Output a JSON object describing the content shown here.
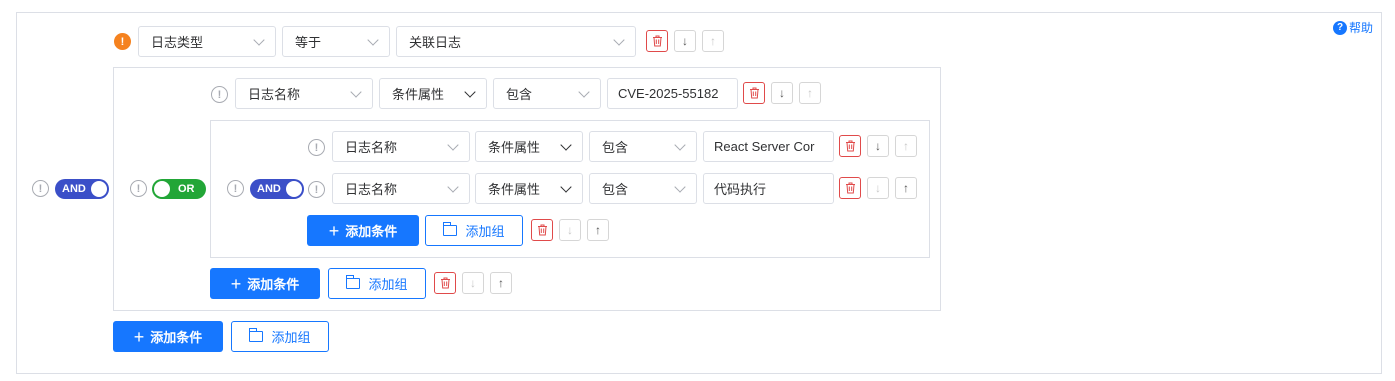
{
  "help": {
    "icon": "help-circle-icon",
    "label": "帮助"
  },
  "toggles": {
    "and_label": "AND",
    "or_label": "OR"
  },
  "top_condition": {
    "field": "日志类型",
    "operator": "等于",
    "value": "关联日志"
  },
  "group1": {
    "condition1": {
      "field": "日志名称",
      "attribute": "条件属性",
      "operator": "包含",
      "value": "CVE-2025-55182"
    },
    "inner_group": {
      "condition1": {
        "field": "日志名称",
        "attribute": "条件属性",
        "operator": "包含",
        "value": "React Server Cor"
      },
      "condition2": {
        "field": "日志名称",
        "attribute": "条件属性",
        "operator": "包含",
        "value": "代码执行"
      }
    }
  },
  "actions": {
    "add_condition": "添加条件",
    "add_group": "添加组"
  },
  "glyphs": {
    "warn": "!",
    "plus": "+",
    "move_down": "↓",
    "move_up": "↑"
  },
  "colors": {
    "primary": "#1677ff",
    "and_toggle": "#3b4fc8",
    "or_toggle": "#22a637",
    "delete": "#e04a4a",
    "warning": "#f5821f"
  }
}
